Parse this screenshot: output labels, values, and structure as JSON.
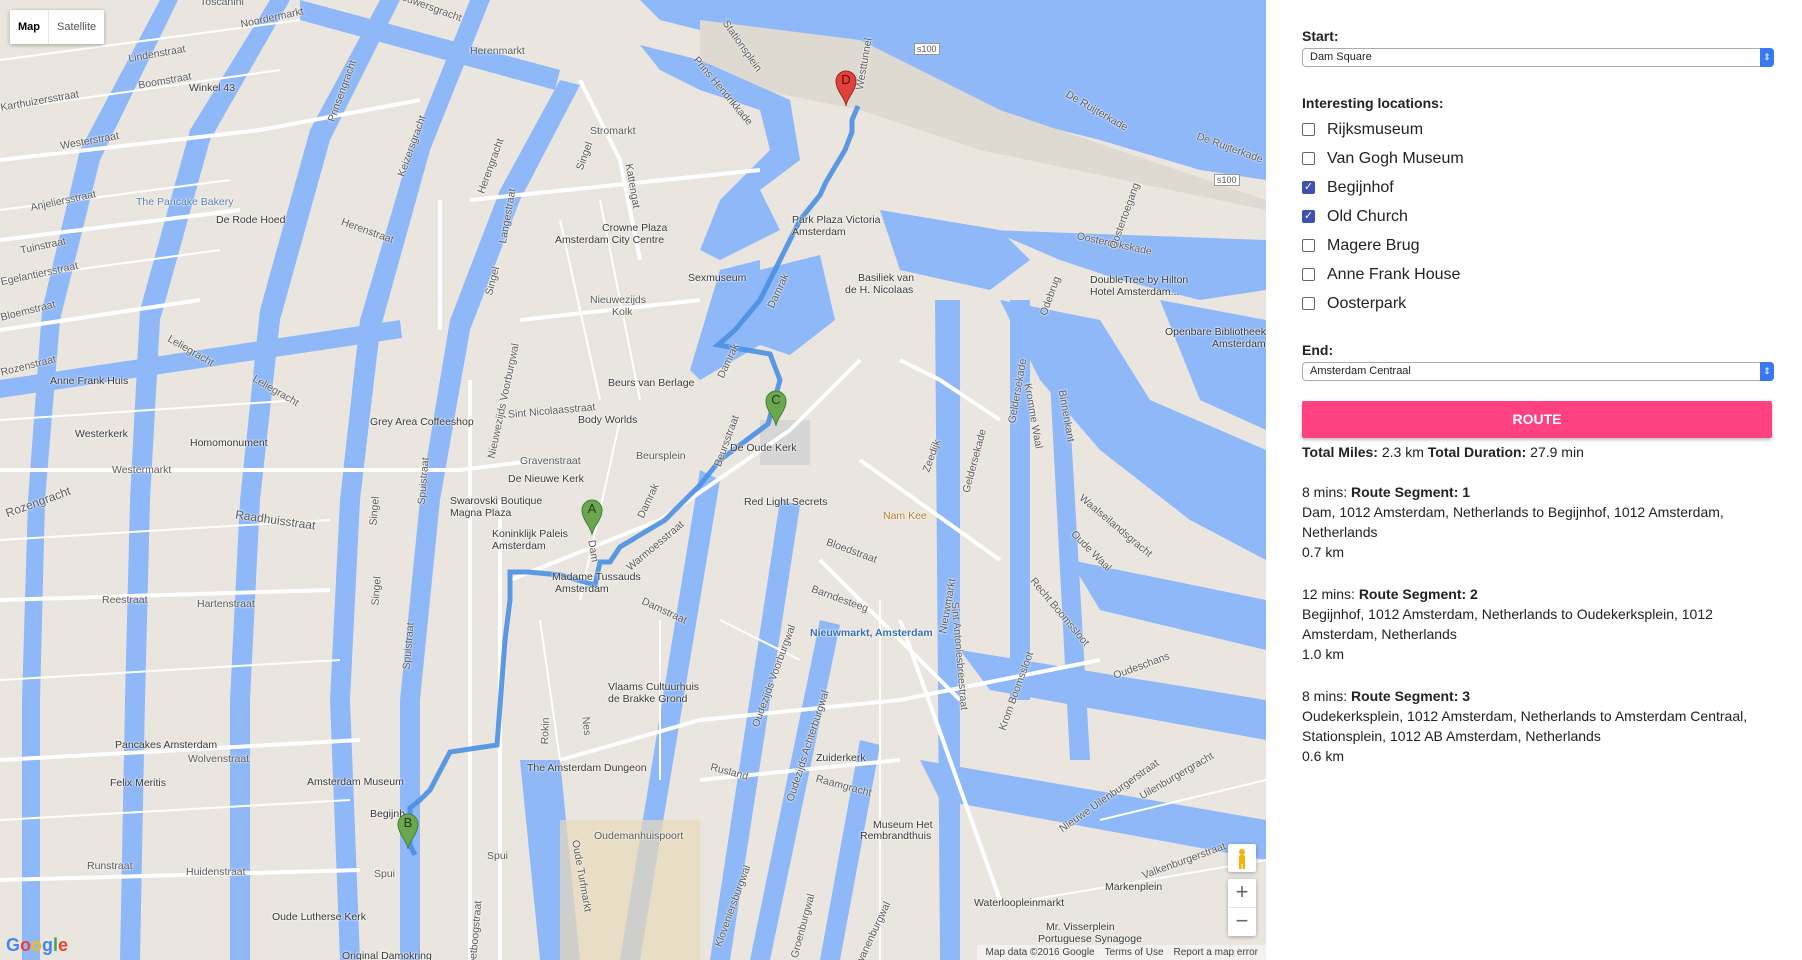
{
  "map": {
    "type_controls": {
      "map": "Map",
      "satellite": "Satellite"
    },
    "zoom": {
      "in": "+",
      "out": "−"
    },
    "footer": {
      "data": "Map data ©2016 Google",
      "terms": "Terms of Use",
      "report": "Report a map error"
    },
    "logo": "Google",
    "markers": [
      "A",
      "B",
      "C",
      "D"
    ],
    "labels": {
      "toscanini": "Toscanini",
      "noordermarkt": "Noordermarkt",
      "lindenstraat": "Lindenstraat",
      "boomstraat": "Boomstraat",
      "winkel43": "Winkel 43",
      "karthuizer": "Karthuizersstraat",
      "westerstraat": "Westerstraat",
      "pancake": "The Pancake Bakery",
      "rodehoed": "De Rode Hoed",
      "anjelier": "Anjeliersstraat",
      "tuin": "Tuinstraat",
      "egelantiers": "Egelantiersstraat",
      "bloemstraat": "Bloemstraat",
      "rozenstraat": "Rozenstraat",
      "leliegracht": "Leliegracht",
      "annefrankhuis": "Anne Frank Huis",
      "westerkerk": "Westerkerk",
      "homomonument": "Homomonument",
      "westermarkt": "Westermarkt",
      "rozengracht": "Rozengracht",
      "raadhuisstraat": "Raadhuisstraat",
      "reestraat": "Reestraat",
      "hartenstraat": "Hartenstraat",
      "wolvenstraat": "Wolvenstraat",
      "pancakes": "Pancakes Amsterdam",
      "felixmeritis": "Felix Meritis",
      "runstraat": "Runstraat",
      "huidenstraat": "Huidenstraat",
      "brouwersgracht": "Brouwersgracht",
      "herenmarkt": "Herenmarkt",
      "prinsengracht": "Prinsengracht",
      "keizersgracht": "Keizersgracht",
      "herengracht": "Herengracht",
      "herenstraat": "Herenstraat",
      "langestraat": "Langestraat",
      "singel": "Singel",
      "stromarkt": "Stromarkt",
      "kattengat": "Kattengat",
      "crowne": "Crowne Plaza",
      "crowne2": "Amsterdam City Centre",
      "nieuwezijdskolk": "Nieuwezijds",
      "nieuwezijdskolk2": "Kolk",
      "greyarea": "Grey Area Coffeeshop",
      "sintnicolaas": "Sint Nicolaasstraat",
      "gravenstraat": "Gravenstraat",
      "nieuwekerk": "De Nieuwe Kerk",
      "swarovski": "Swarovski Boutique",
      "swarovski2": "Magna Plaza",
      "paleis": "Koninklijk Paleis",
      "paleis2": "Amsterdam",
      "tussauds": "Madame Tussauds",
      "tussauds2": "Amsterdam",
      "beursberlage": "Beurs van Berlage",
      "bodyworlds": "Body Worlds",
      "beursplein": "Beursplein",
      "beursstraat": "Beursstraat",
      "oudekerk": "De Oude Kerk",
      "redlight": "Red Light Secrets",
      "namkee": "Nam Kee",
      "damstraat": "Damstraat",
      "warmoesstraat": "Warmoesstraat",
      "damrak": "Damrak",
      "sexmuseum": "Sexmuseum",
      "parkplaza": "Park Plaza Victoria",
      "parkplaza2": "Amsterdam",
      "basiliek": "Basiliek van",
      "basiliek2": "de H. Nicolaas",
      "stationsplein": "Stationsplein",
      "prinshendrikkade": "Prins Hendrikkade",
      "westtunnel": "Westtunnel",
      "deruijterkade": "De Ruijterkade",
      "oosterdokskade": "Oosterdokskade",
      "oosterdoksstraat": "Oosterdoksstraat",
      "doubletree": "DoubleTree by Hilton",
      "doubletree2": "Hotel Amsterdam...",
      "openbare": "Openbare Bibliotheek",
      "openbare2": "Amsterdam",
      "oostertoegang": "Oostertoegang",
      "odebrug": "Odebrug",
      "geldersekade": "Geldersekade",
      "zeedijk": "Zeedijk",
      "binnenkant": "Binnenkant",
      "kromme": "Kromme Waal",
      "waalseilandsgracht": "Waalseilandsgracht",
      "oudewaal": "Oude Waal",
      "rechtboomssloot": "Recht Boomssloot",
      "kromboomssloot": "Krom Boomssloot",
      "oudeschans": "Oudeschans",
      "nieuweuilenburger": "Nieuwe Uilenburgerstraat",
      "uilenburgergracht": "Uilenburgergracht",
      "valkenburgerstraat": "Valkenburgerstraat",
      "nieuwmarkt": "Nieuwmarkt",
      "nieuwmarktstation": "Nieuwmarkt, Amsterdam",
      "bloedstraat": "Bloedstraat",
      "barndesteeg": "Barndesteeg",
      "oudezijdsvoorburgwal": "Oudezijds Voorburgwal",
      "oudezijdsachterburgwal": "Oudezijds Achterburgwal",
      "vlaams": "Vlaams Cultuurhuis",
      "vlaams2": "de Brakke Grond",
      "nes": "Nes",
      "rokin": "Rokin",
      "dungeon": "The Amsterdam Dungeon",
      "spuistraat": "Spuistraat",
      "nieuwezijdsvoorburgwal": "Nieuwezijds Voorburgwal",
      "amsmuseum": "Amsterdam Museum",
      "begijnhof": "Begijnh",
      "spui": "Spui",
      "spui2": "Spui",
      "voetboog": "Voetboogstraat",
      "oudelutherse": "Oude Lutherse Kerk",
      "damokring": "Original Damokring",
      "oudemanhuispoort": "Oudemanhuispoort",
      "oudeturfmarkt": "Oude Turfmarkt",
      "kloveniersburgwal": "Kloveniersburgwal",
      "rusland": "Rusland",
      "zuiderkerk": "Zuiderkerk",
      "raamgracht": "Raamgracht",
      "rembrandthuis": "Museum Het",
      "rembrandthuis2": "Rembrandthuis",
      "groenburgwal": "Groenburgwal",
      "zwanenburgwal": "Zwanenburgwal",
      "waterlooplein": "Waterloopleinmarkt",
      "markenplein": "Markenplein",
      "visserplein": "Mr. Visserplein",
      "synagoge": "Portuguese Synagoge",
      "stantonies": "Sint Antoniesbreestraat",
      "s100a": "s100",
      "s100b": "s100",
      "dam": "Dam"
    }
  },
  "panel": {
    "start_label": "Start:",
    "start_value": "Dam Square",
    "locations_label": "Interesting locations:",
    "locations": [
      {
        "label": "Rijksmuseum",
        "checked": false
      },
      {
        "label": "Van Gogh Museum",
        "checked": false
      },
      {
        "label": "Begijnhof",
        "checked": true
      },
      {
        "label": "Old Church",
        "checked": true
      },
      {
        "label": "Magere Brug",
        "checked": false
      },
      {
        "label": "Anne Frank House",
        "checked": false
      },
      {
        "label": "Oosterpark",
        "checked": false
      }
    ],
    "end_label": "End:",
    "end_value": "Amsterdam Centraal",
    "route_button": "ROUTE",
    "totals": {
      "miles_label": "Total Miles:",
      "miles_value": "2.3 km",
      "duration_label": "Total Duration:",
      "duration_value": "27.9 min"
    },
    "segments": [
      {
        "time": "8 mins:",
        "title": "Route Segment: 1",
        "desc": "Dam, 1012 Amsterdam, Netherlands to Begijnhof, 1012 Amsterdam, Netherlands",
        "distance": "0.7 km"
      },
      {
        "time": "12 mins:",
        "title": "Route Segment: 2",
        "desc": "Begijnhof, 1012 Amsterdam, Netherlands to Oudekerksplein, 1012 Amsterdam, Netherlands",
        "distance": "1.0 km"
      },
      {
        "time": "8 mins:",
        "title": "Route Segment: 3",
        "desc": "Oudekerksplein, 1012 Amsterdam, Netherlands to Amsterdam Centraal, Stationsplein, 1012 AB Amsterdam, Netherlands",
        "distance": "0.6 km"
      }
    ]
  },
  "colors": {
    "water": "#8fb8f9",
    "route": "#4a90e2",
    "marker_green": "#6aa84f",
    "marker_red": "#e0413a",
    "button": "#ff4081",
    "checkbox": "#3f51b5"
  }
}
